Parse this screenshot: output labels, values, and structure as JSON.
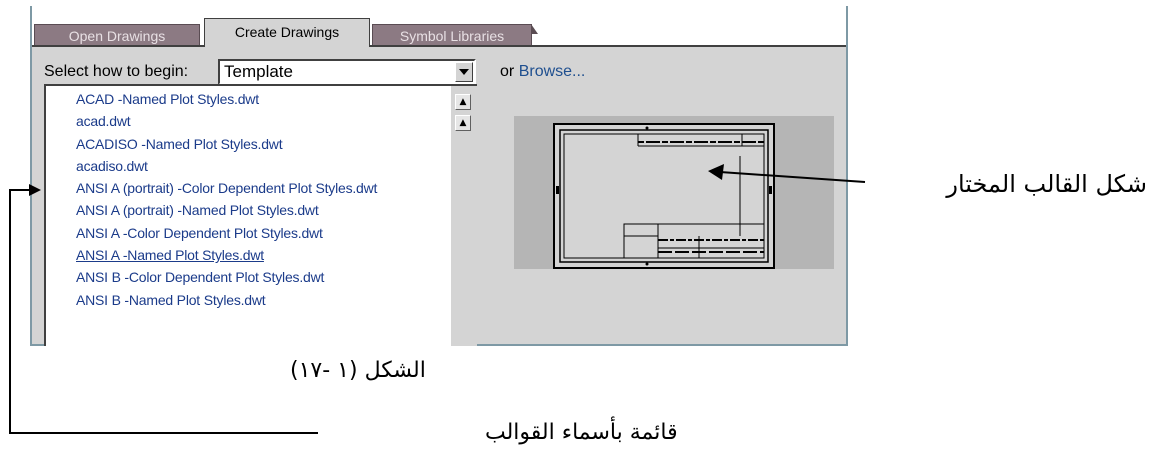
{
  "tabs": [
    {
      "label": "Open Drawings",
      "active": false
    },
    {
      "label": "Create Drawings",
      "active": true
    },
    {
      "label": "Symbol Libraries",
      "active": false
    }
  ],
  "select_row": {
    "label": "Select how to begin:",
    "value": "Template",
    "or_text": "or",
    "browse_label": "Browse..."
  },
  "template_list": {
    "items": [
      "ACAD -Named Plot Styles.dwt",
      "acad.dwt",
      "ACADISO -Named Plot Styles.dwt",
      "acadiso.dwt",
      "ANSI A (portrait) -Color Dependent Plot Styles.dwt",
      "ANSI A (portrait) -Named Plot Styles.dwt",
      "ANSI A -Color Dependent Plot Styles.dwt",
      "ANSI A -Named Plot Styles.dwt",
      "ANSI B -Color Dependent Plot Styles.dwt",
      "ANSI B -Named Plot Styles.dwt"
    ],
    "selected_index": 7
  },
  "annotations": {
    "selected_template_shape": "شكل القالب المختار",
    "figure_caption": "الشكل (١  -١٧)",
    "template_names_list": "قائمة بأسماء القوالب"
  },
  "colors": {
    "tab_inactive": "#8c7a83",
    "panel": "#d4d4d4",
    "link": "#1b3b8a",
    "panel_border": "#7e99a5"
  },
  "icons": {
    "combo_dropdown": "down-triangle",
    "scroll_top": "double-up-arrow",
    "scroll_up": "up-arrow"
  }
}
